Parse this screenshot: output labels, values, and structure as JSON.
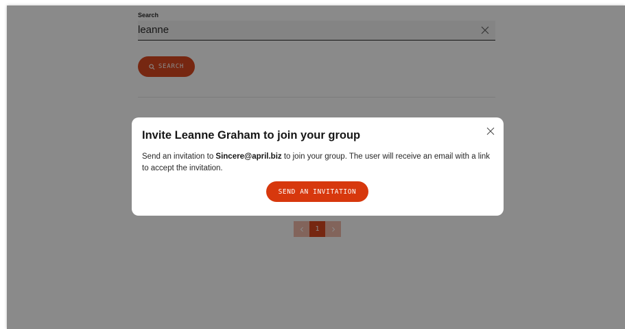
{
  "search": {
    "label": "Search",
    "value": "leanne",
    "button_label": "SEARCH"
  },
  "pagination": {
    "current_page": "1"
  },
  "modal": {
    "title": "Invite Leanne Graham to join your group",
    "body_prefix": "Send an invitation to ",
    "email": "Sincere@april.biz",
    "body_suffix": " to join your group. The user will receive an email with a link to accept the invitation.",
    "button_label": "SEND AN INVITATION"
  },
  "colors": {
    "accent": "#d7380d",
    "overlay": "#161616"
  }
}
